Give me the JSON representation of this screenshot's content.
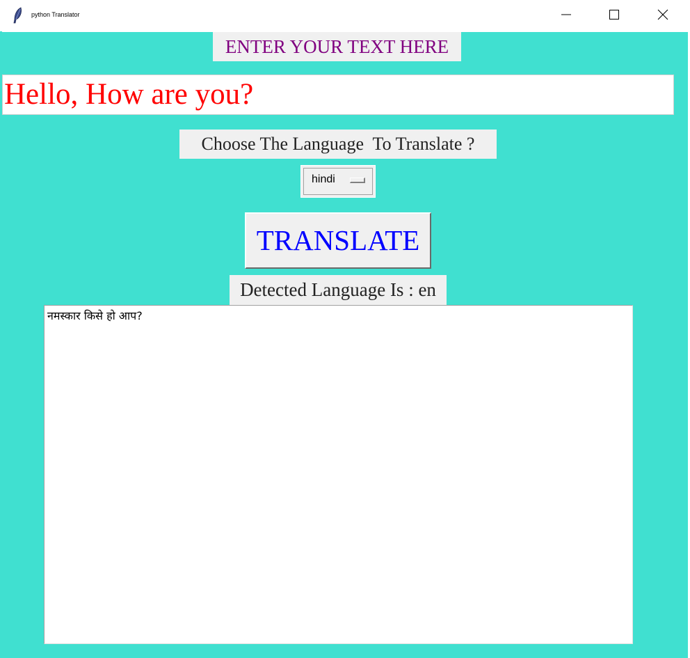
{
  "window": {
    "title": "python Translator",
    "icon": "feather-icon"
  },
  "main": {
    "heading": "ENTER YOUR TEXT HERE",
    "input_text": "Hello, How are you?",
    "choose_label": "Choose The Language  To Translate ?",
    "language_selected": "hindi",
    "translate_button": "TRANSLATE",
    "detected_label": "Detected Language Is : en",
    "output_text": "नमस्कार किसे हो आप?"
  },
  "colors": {
    "background": "#40e0d0",
    "heading": "#800080",
    "input_text": "#ff0000",
    "button_text": "#0000ff"
  }
}
